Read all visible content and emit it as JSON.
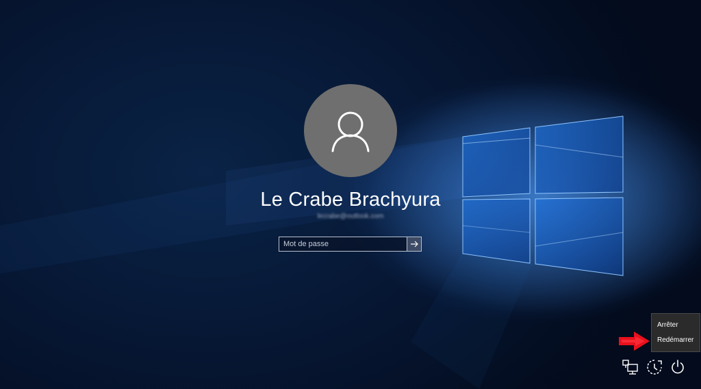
{
  "user": {
    "name": "Le Crabe Brachyura",
    "email": "lecrabe@outlook.com"
  },
  "password": {
    "placeholder": "Mot de passe",
    "value": ""
  },
  "power_menu": {
    "items": [
      {
        "label": "Arrêter"
      },
      {
        "label": "Redémarrer"
      }
    ]
  },
  "icons": {
    "avatar": "user-silhouette-icon",
    "submit": "arrow-right-icon",
    "network": "network-icon",
    "accessibility": "ease-of-access-icon",
    "power": "power-icon",
    "pointer": "red-arrow-icon"
  },
  "colors": {
    "background": "#061632",
    "avatar_bg": "#6f6f6f",
    "submit_bg": "#3d4b66",
    "menu_bg": "#2b2b2b",
    "pointer_arrow": "#e8101c",
    "windows_logo": "#3a8df0"
  }
}
